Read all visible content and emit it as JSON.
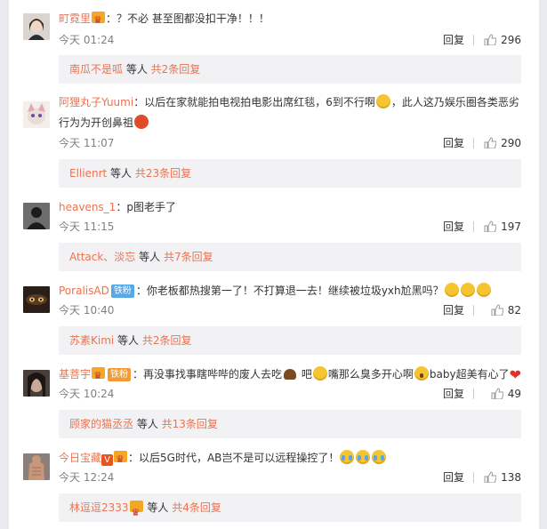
{
  "comments": [
    {
      "user": "町霓里",
      "text": "：？不必 甚至图都没扣干净！！！",
      "time": "今天 01:24",
      "reply": "回复",
      "likes": "296",
      "thread": {
        "nick": "南瓜不是呱",
        "mid": " 等人 ",
        "count": "共2条回复"
      }
    },
    {
      "user": "阿狸丸子Yuumi",
      "text_a": "：以后在家就能拍电视拍电影出席红毯，6到不行啊",
      "text_b": "，此人这乃娱乐圈各类恶劣",
      "text_c": "行为为开创鼻祖",
      "time": "今天 11:07",
      "reply": "回复",
      "likes": "290",
      "thread": {
        "nick": "Ellienrt",
        "mid": " 等人 ",
        "count": "共23条回复"
      }
    },
    {
      "user": "heavens_1",
      "text": "：p图老手了",
      "time": "今天 11:15",
      "reply": "回复",
      "likes": "197",
      "thread": {
        "nick": "Attack、淡忘",
        "mid": " 等人 ",
        "count": "共7条回复"
      }
    },
    {
      "user": "PoralisAD",
      "badge": "铁粉",
      "text": "：你老板都热搜第一了！不打算退一去！继续被垃圾yxh尬黑吗？",
      "time": "今天 10:40",
      "reply": "回复",
      "likes": "82",
      "thread": {
        "nick": "苏素Kimi",
        "mid": " 等人 ",
        "count": "共2条回复"
      }
    },
    {
      "user": "基菩宇",
      "badge": "铁粉",
      "text_a": "：再没事找事瞎哔哔的废人去吃",
      "text_b": " 吧",
      "text_c": "嘴那么臭多开心啊",
      "text_d": "baby超美有心了",
      "time": "今天 10:24",
      "reply": "回复",
      "likes": "49",
      "thread": {
        "nick": "顾家的猫丞丞",
        "mid": " 等人 ",
        "count": "共13条回复"
      }
    },
    {
      "user": "今日宝藏",
      "text": "：以后5G时代，AB岂不是可以远程操控了！",
      "time": "今天 12:24",
      "reply": "回复",
      "likes": "138",
      "thread": {
        "nick": "林逗逗2333",
        "mid": " 等人 ",
        "count": "共4条回复"
      }
    }
  ]
}
